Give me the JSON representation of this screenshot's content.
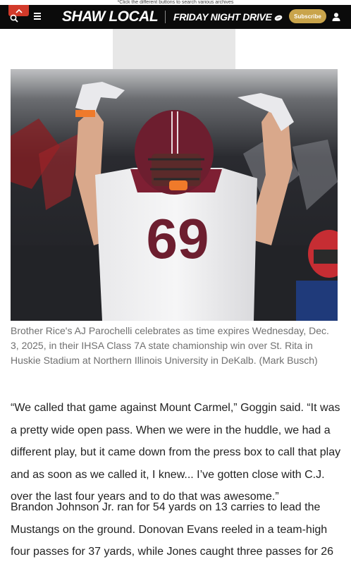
{
  "top_hint": "*Click the different buttons to search various archives",
  "header": {
    "logo": "SHAW LOCAL",
    "sub_brand": "FRIDAY NIGHT DRIVE",
    "subscribe_label": "Subscribe"
  },
  "article": {
    "photo_caption": "Brother Rice's AJ Parochelli celebrates as time expires Wednesday, Dec. 3, 2025, in their IHSA Class 7A state chamionship win over St. Rita in Huskie Stadium at Northern Illinois University in DeKalb. (Mark Busch)",
    "jersey_number": "69",
    "paragraphs": [
      "“We called that game against Mount Carmel,” Goggin said. “It was a pretty wide open pass. When we were in the huddle, we had a different play, but it came down from the press box to call that play and as soon as we called it, I knew... I’ve gotten close with C.J. over the last four years and to do that was awesome.”",
      "Brandon Johnson Jr. ran for 54 yards on 13 carries to lead the Mustangs on the ground. Donovan Evans reeled in a team-high four passes for 37 yards, while Jones caught three passes for 26"
    ]
  },
  "colors": {
    "navbar_bg": "#0b0b0b",
    "scroll_top_button": "#d23a2a",
    "subscribe_button": "#c9a44b",
    "caption_text": "#707070",
    "body_text": "#222222"
  }
}
